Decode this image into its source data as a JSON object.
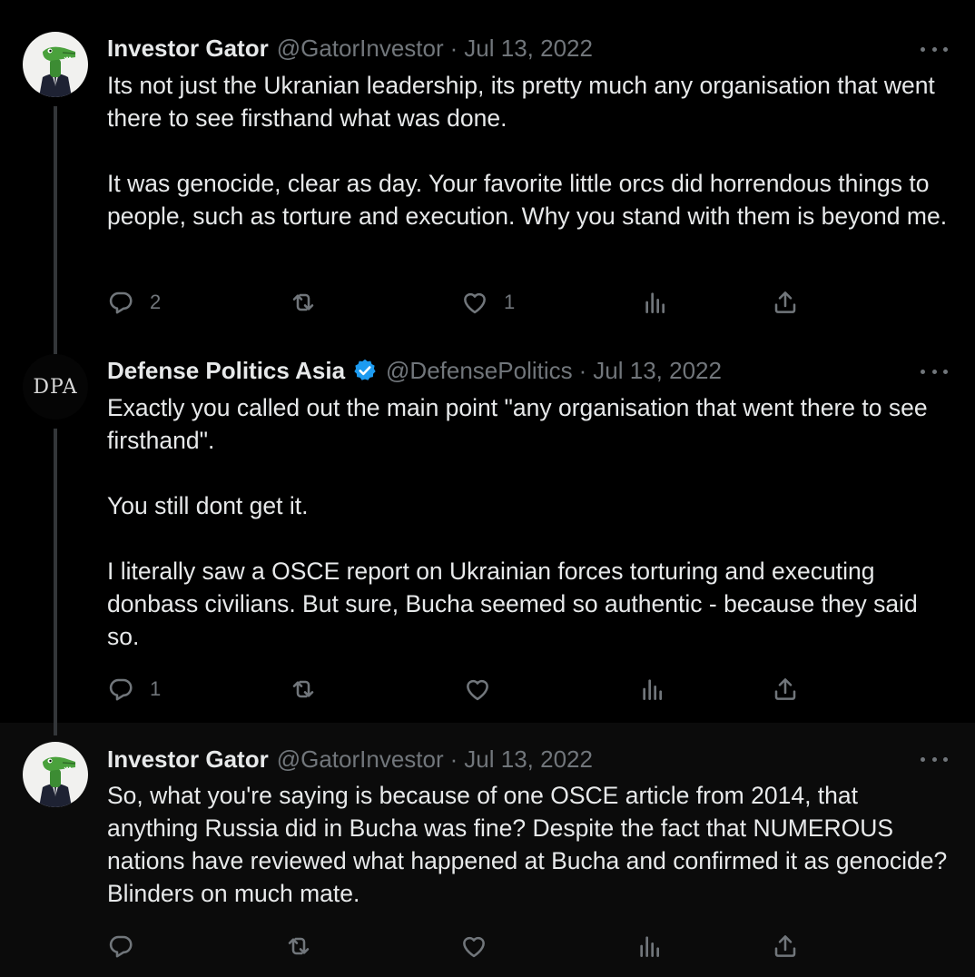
{
  "tweets": [
    {
      "name": "Investor Gator",
      "handle": "@GatorInvestor",
      "separator": "·",
      "date": "Jul 13, 2022",
      "verified": false,
      "avatar": "gator-avatar",
      "text": "Its not just the Ukranian leadership, its pretty much any organisation that went there to see firsthand what was done.\n\nIt was genocide, clear as day. Your favorite little orcs did horrendous things to people, such as torture and execution. Why you stand with them is beyond me.",
      "replies": "2",
      "retweets": "",
      "likes": "1"
    },
    {
      "name": "Defense Politics Asia",
      "handle": "@DefensePolitics",
      "separator": "·",
      "date": "Jul 13, 2022",
      "verified": true,
      "avatar": "dpa-logo",
      "avatar_text": "DPA",
      "text": "Exactly you called out the main point \"any organisation that went there to see firsthand\".\n\nYou still dont get it.\n\nI literally saw a OSCE report on Ukrainian forces torturing and executing donbass civilians. But sure, Bucha seemed so authentic - because they said so.",
      "replies": "1",
      "retweets": "",
      "likes": ""
    },
    {
      "name": "Investor Gator",
      "handle": "@GatorInvestor",
      "separator": "·",
      "date": "Jul 13, 2022",
      "verified": false,
      "avatar": "gator-avatar",
      "text": "So, what you're saying is because of one OSCE article from 2014, that anything Russia did in Bucha was fine? Despite the fact that NUMEROUS nations have reviewed what happened at Bucha and confirmed it as genocide? Blinders on much mate.",
      "replies": "",
      "retweets": "",
      "likes": ""
    }
  ],
  "icons": [
    "reply-icon",
    "retweet-icon",
    "like-icon",
    "views-icon",
    "share-icon",
    "more-icon",
    "verified-badge-icon"
  ],
  "colors": {
    "background": "#000000",
    "text": "#e7e9ea",
    "secondary": "#71767b",
    "verified": "#1d9bf0",
    "thread_line": "#333639"
  }
}
